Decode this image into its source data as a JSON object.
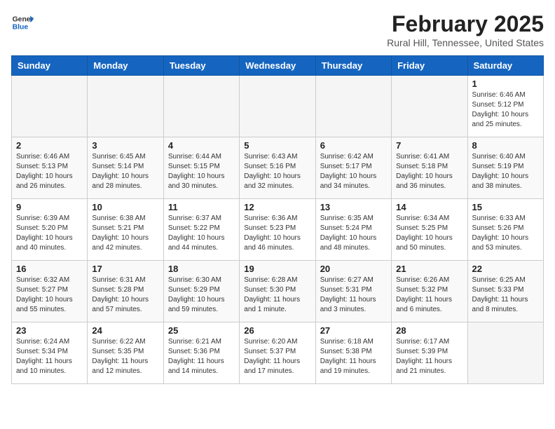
{
  "header": {
    "logo_general": "General",
    "logo_blue": "Blue",
    "month_title": "February 2025",
    "location": "Rural Hill, Tennessee, United States"
  },
  "weekdays": [
    "Sunday",
    "Monday",
    "Tuesday",
    "Wednesday",
    "Thursday",
    "Friday",
    "Saturday"
  ],
  "weeks": [
    [
      {
        "day": "",
        "info": ""
      },
      {
        "day": "",
        "info": ""
      },
      {
        "day": "",
        "info": ""
      },
      {
        "day": "",
        "info": ""
      },
      {
        "day": "",
        "info": ""
      },
      {
        "day": "",
        "info": ""
      },
      {
        "day": "1",
        "info": "Sunrise: 6:46 AM\nSunset: 5:12 PM\nDaylight: 10 hours and 25 minutes."
      }
    ],
    [
      {
        "day": "2",
        "info": "Sunrise: 6:46 AM\nSunset: 5:13 PM\nDaylight: 10 hours and 26 minutes."
      },
      {
        "day": "3",
        "info": "Sunrise: 6:45 AM\nSunset: 5:14 PM\nDaylight: 10 hours and 28 minutes."
      },
      {
        "day": "4",
        "info": "Sunrise: 6:44 AM\nSunset: 5:15 PM\nDaylight: 10 hours and 30 minutes."
      },
      {
        "day": "5",
        "info": "Sunrise: 6:43 AM\nSunset: 5:16 PM\nDaylight: 10 hours and 32 minutes."
      },
      {
        "day": "6",
        "info": "Sunrise: 6:42 AM\nSunset: 5:17 PM\nDaylight: 10 hours and 34 minutes."
      },
      {
        "day": "7",
        "info": "Sunrise: 6:41 AM\nSunset: 5:18 PM\nDaylight: 10 hours and 36 minutes."
      },
      {
        "day": "8",
        "info": "Sunrise: 6:40 AM\nSunset: 5:19 PM\nDaylight: 10 hours and 38 minutes."
      }
    ],
    [
      {
        "day": "9",
        "info": "Sunrise: 6:39 AM\nSunset: 5:20 PM\nDaylight: 10 hours and 40 minutes."
      },
      {
        "day": "10",
        "info": "Sunrise: 6:38 AM\nSunset: 5:21 PM\nDaylight: 10 hours and 42 minutes."
      },
      {
        "day": "11",
        "info": "Sunrise: 6:37 AM\nSunset: 5:22 PM\nDaylight: 10 hours and 44 minutes."
      },
      {
        "day": "12",
        "info": "Sunrise: 6:36 AM\nSunset: 5:23 PM\nDaylight: 10 hours and 46 minutes."
      },
      {
        "day": "13",
        "info": "Sunrise: 6:35 AM\nSunset: 5:24 PM\nDaylight: 10 hours and 48 minutes."
      },
      {
        "day": "14",
        "info": "Sunrise: 6:34 AM\nSunset: 5:25 PM\nDaylight: 10 hours and 50 minutes."
      },
      {
        "day": "15",
        "info": "Sunrise: 6:33 AM\nSunset: 5:26 PM\nDaylight: 10 hours and 53 minutes."
      }
    ],
    [
      {
        "day": "16",
        "info": "Sunrise: 6:32 AM\nSunset: 5:27 PM\nDaylight: 10 hours and 55 minutes."
      },
      {
        "day": "17",
        "info": "Sunrise: 6:31 AM\nSunset: 5:28 PM\nDaylight: 10 hours and 57 minutes."
      },
      {
        "day": "18",
        "info": "Sunrise: 6:30 AM\nSunset: 5:29 PM\nDaylight: 10 hours and 59 minutes."
      },
      {
        "day": "19",
        "info": "Sunrise: 6:28 AM\nSunset: 5:30 PM\nDaylight: 11 hours and 1 minute."
      },
      {
        "day": "20",
        "info": "Sunrise: 6:27 AM\nSunset: 5:31 PM\nDaylight: 11 hours and 3 minutes."
      },
      {
        "day": "21",
        "info": "Sunrise: 6:26 AM\nSunset: 5:32 PM\nDaylight: 11 hours and 6 minutes."
      },
      {
        "day": "22",
        "info": "Sunrise: 6:25 AM\nSunset: 5:33 PM\nDaylight: 11 hours and 8 minutes."
      }
    ],
    [
      {
        "day": "23",
        "info": "Sunrise: 6:24 AM\nSunset: 5:34 PM\nDaylight: 11 hours and 10 minutes."
      },
      {
        "day": "24",
        "info": "Sunrise: 6:22 AM\nSunset: 5:35 PM\nDaylight: 11 hours and 12 minutes."
      },
      {
        "day": "25",
        "info": "Sunrise: 6:21 AM\nSunset: 5:36 PM\nDaylight: 11 hours and 14 minutes."
      },
      {
        "day": "26",
        "info": "Sunrise: 6:20 AM\nSunset: 5:37 PM\nDaylight: 11 hours and 17 minutes."
      },
      {
        "day": "27",
        "info": "Sunrise: 6:18 AM\nSunset: 5:38 PM\nDaylight: 11 hours and 19 minutes."
      },
      {
        "day": "28",
        "info": "Sunrise: 6:17 AM\nSunset: 5:39 PM\nDaylight: 11 hours and 21 minutes."
      },
      {
        "day": "",
        "info": ""
      }
    ]
  ]
}
